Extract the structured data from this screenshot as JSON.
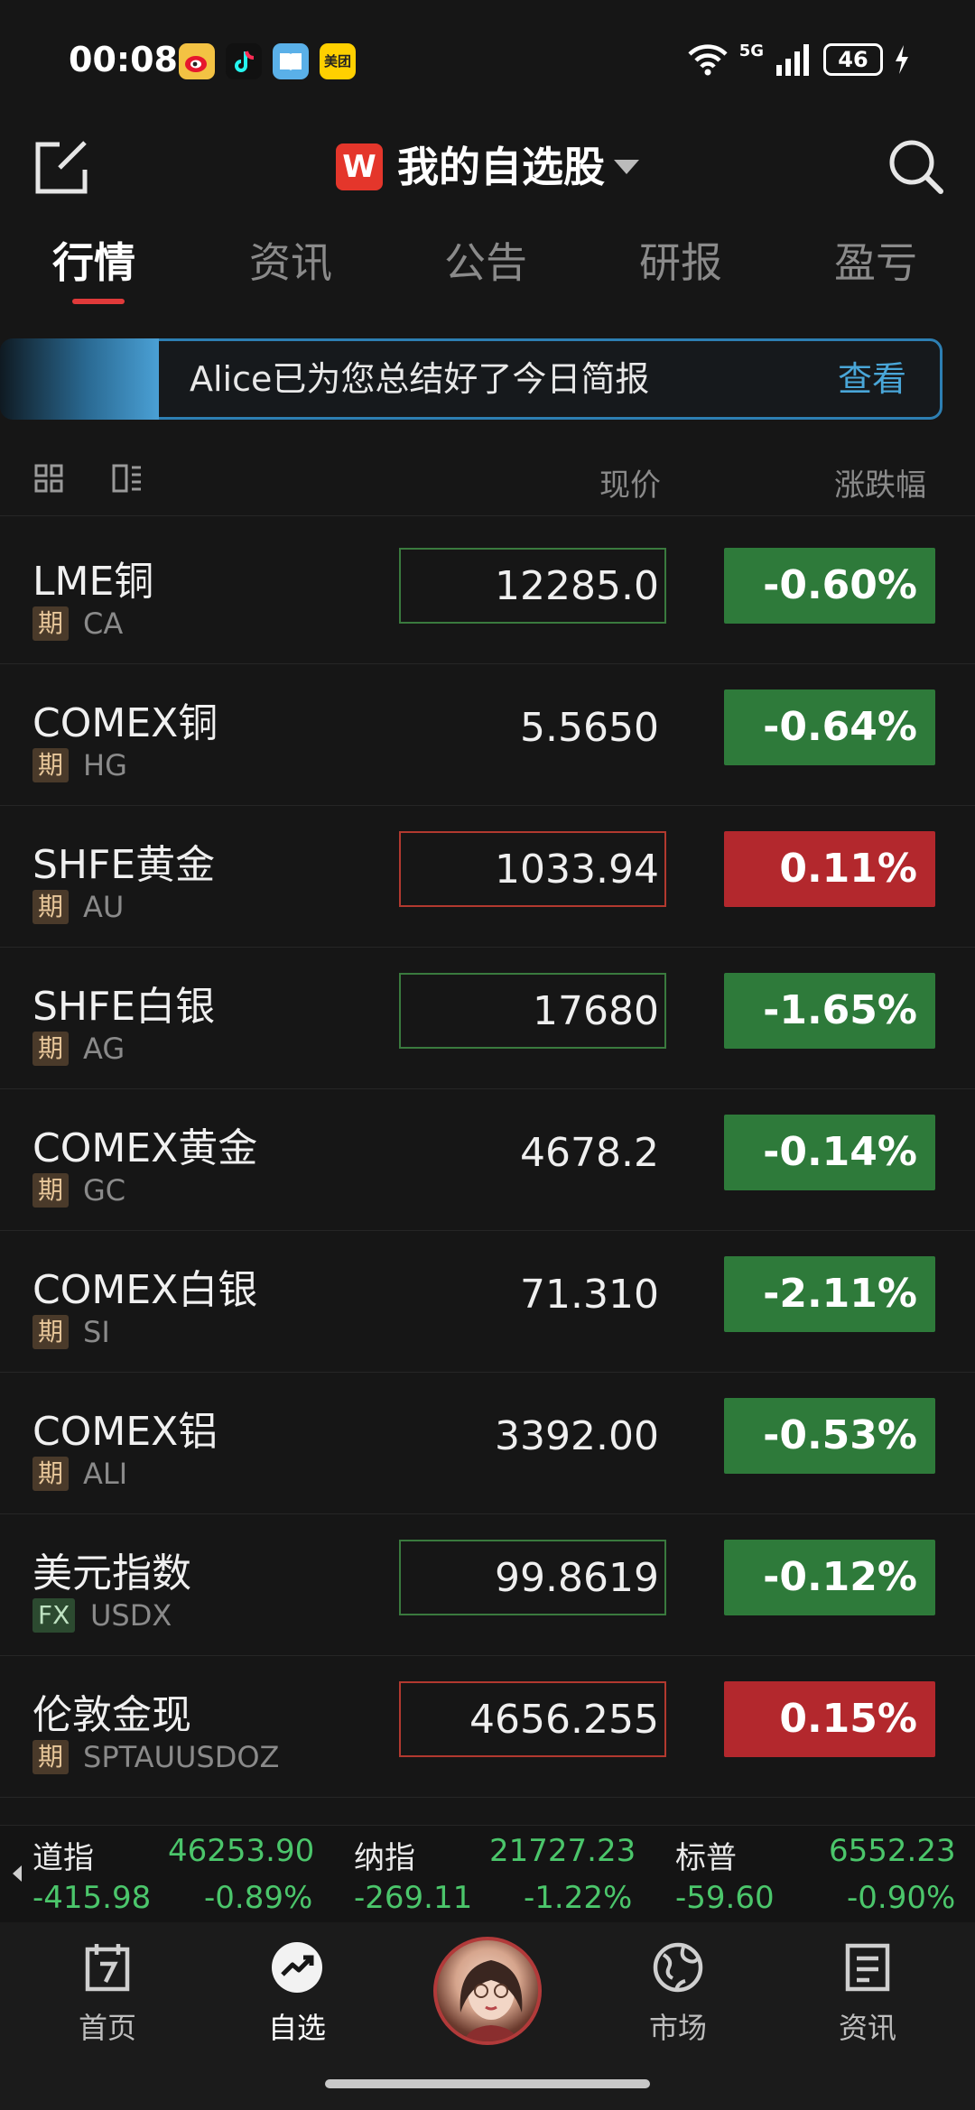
{
  "status_bar": {
    "time": "00:08",
    "apps": [
      {
        "icon": "weibo-icon",
        "label": "",
        "color": "#f3c243"
      },
      {
        "icon": "douyin-icon",
        "label": "",
        "color": "#111111"
      },
      {
        "icon": "book-icon",
        "label": "",
        "color": "#5ab0e8"
      },
      {
        "icon": "meituan-icon",
        "label": "美团",
        "color": "#ffd000"
      }
    ],
    "network": "5G",
    "battery": "46"
  },
  "header": {
    "logo": "W",
    "title": "我的自选股"
  },
  "tabs": [
    {
      "label": "行情",
      "active": true
    },
    {
      "label": "资讯",
      "active": false
    },
    {
      "label": "公告",
      "active": false
    },
    {
      "label": "研报",
      "active": false
    },
    {
      "label": "盈亏",
      "active": false
    }
  ],
  "banner": {
    "text": "Alice已为您总结好了今日简报",
    "link": "查看"
  },
  "columns": {
    "price": "现价",
    "change": "涨跌幅"
  },
  "colors": {
    "up": "#b3282d",
    "down": "#2e7a3a",
    "up_border": "#b2392f",
    "down_border": "#3a7a3e",
    "index_green": "#4bc66b"
  },
  "rows": [
    {
      "name": "LME铜",
      "tag": "期",
      "code": "CA",
      "price": "12285.0",
      "change": "-0.60%",
      "dir": "down",
      "flash": true
    },
    {
      "name": "COMEX铜",
      "tag": "期",
      "code": "HG",
      "price": "5.5650",
      "change": "-0.64%",
      "dir": "down",
      "flash": false
    },
    {
      "name": "SHFE黄金",
      "tag": "期",
      "code": "AU",
      "price": "1033.94",
      "change": "0.11%",
      "dir": "up",
      "flash": true
    },
    {
      "name": "SHFE白银",
      "tag": "期",
      "code": "AG",
      "price": "17680",
      "change": "-1.65%",
      "dir": "down",
      "flash": true
    },
    {
      "name": "COMEX黄金",
      "tag": "期",
      "code": "GC",
      "price": "4678.2",
      "change": "-0.14%",
      "dir": "down",
      "flash": false
    },
    {
      "name": "COMEX白银",
      "tag": "期",
      "code": "SI",
      "price": "71.310",
      "change": "-2.11%",
      "dir": "down",
      "flash": false
    },
    {
      "name": "COMEX铝",
      "tag": "期",
      "code": "ALI",
      "price": "3392.00",
      "change": "-0.53%",
      "dir": "down",
      "flash": false
    },
    {
      "name": "美元指数",
      "tag": "FX",
      "code": "USDX",
      "price": "99.8619",
      "change": "-0.12%",
      "dir": "down",
      "flash": true
    },
    {
      "name": "伦敦金现",
      "tag": "期",
      "code": "SPTAUUSDOZ",
      "price": "4656.255",
      "change": "0.15%",
      "dir": "up",
      "flash": true
    }
  ],
  "indices": [
    {
      "name": "道指",
      "value": "46253.90",
      "change": "-415.98",
      "pct": "-0.89%"
    },
    {
      "name": "纳指",
      "value": "21727.23",
      "change": "-269.11",
      "pct": "-1.22%"
    },
    {
      "name": "标普",
      "value": "6552.23",
      "change": "-59.60",
      "pct": "-0.90%"
    }
  ],
  "nav": [
    {
      "label": "首页",
      "icon": "calendar-icon"
    },
    {
      "label": "自选",
      "icon": "trend-icon",
      "active": true
    },
    {
      "label": "",
      "icon": "avatar"
    },
    {
      "label": "市场",
      "icon": "globe-icon"
    },
    {
      "label": "资讯",
      "icon": "news-icon"
    }
  ]
}
